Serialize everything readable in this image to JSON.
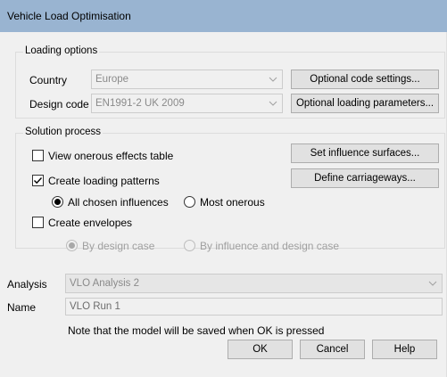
{
  "window": {
    "title": "Vehicle Load Optimisation"
  },
  "loading_options": {
    "group_label": "Loading options",
    "country_label": "Country",
    "country_value": "Europe",
    "design_code_label": "Design code",
    "design_code_value": "EN1991-2 UK 2009",
    "optional_code_settings": "Optional code settings...",
    "optional_loading_parameters": "Optional loading parameters..."
  },
  "solution_process": {
    "group_label": "Solution process",
    "view_onerous_label": "View onerous effects table",
    "view_onerous_checked": false,
    "create_loading_patterns_label": "Create loading patterns",
    "create_loading_patterns_checked": true,
    "all_chosen_influences_label": "All chosen influences",
    "most_onerous_label": "Most onerous",
    "create_envelopes_label": "Create envelopes",
    "create_envelopes_checked": false,
    "by_design_case_label": "By design case",
    "by_influence_and_design_case_label": "By influence and design case",
    "set_influence_surfaces": "Set influence surfaces...",
    "define_carriageways": "Define carriageways..."
  },
  "analysis": {
    "label": "Analysis",
    "value": "VLO Analysis 2"
  },
  "name": {
    "label": "Name",
    "value": "VLO Run 1"
  },
  "note": "Note that the model will be saved when OK is pressed",
  "buttons": {
    "ok": "OK",
    "cancel": "Cancel",
    "help": "Help"
  }
}
